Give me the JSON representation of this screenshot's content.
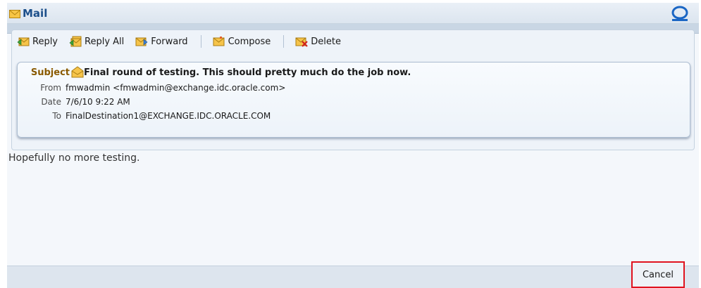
{
  "window": {
    "title": "Mail"
  },
  "toolbar": {
    "reply": "Reply",
    "reply_all": "Reply All",
    "forward": "Forward",
    "compose": "Compose",
    "delete": "Delete"
  },
  "message": {
    "subject_label": "Subject",
    "subject": "Final round of testing. This should pretty much do the job now.",
    "from_label": "From",
    "from": "fmwadmin <fmwadmin@exchange.idc.oracle.com>",
    "date_label": "Date",
    "date": "7/6/10 9:22 AM",
    "to_label": "To",
    "to": "FinalDestination1@EXCHANGE.IDC.ORACLE.COM",
    "body": "Hopefully no more testing."
  },
  "footer": {
    "cancel": "Cancel"
  },
  "colors": {
    "title": "#1c4f8a",
    "subject_label": "#8a5a00",
    "highlight_border": "#e0131e",
    "oracle_logo": "#1a66c4"
  },
  "icons": {
    "title": "envelope-icon",
    "reply": "reply-icon",
    "reply_all": "reply-all-icon",
    "forward": "forward-icon",
    "compose": "compose-icon",
    "delete": "delete-icon",
    "subject": "open-envelope-icon",
    "logo": "oracle-logo-icon"
  }
}
